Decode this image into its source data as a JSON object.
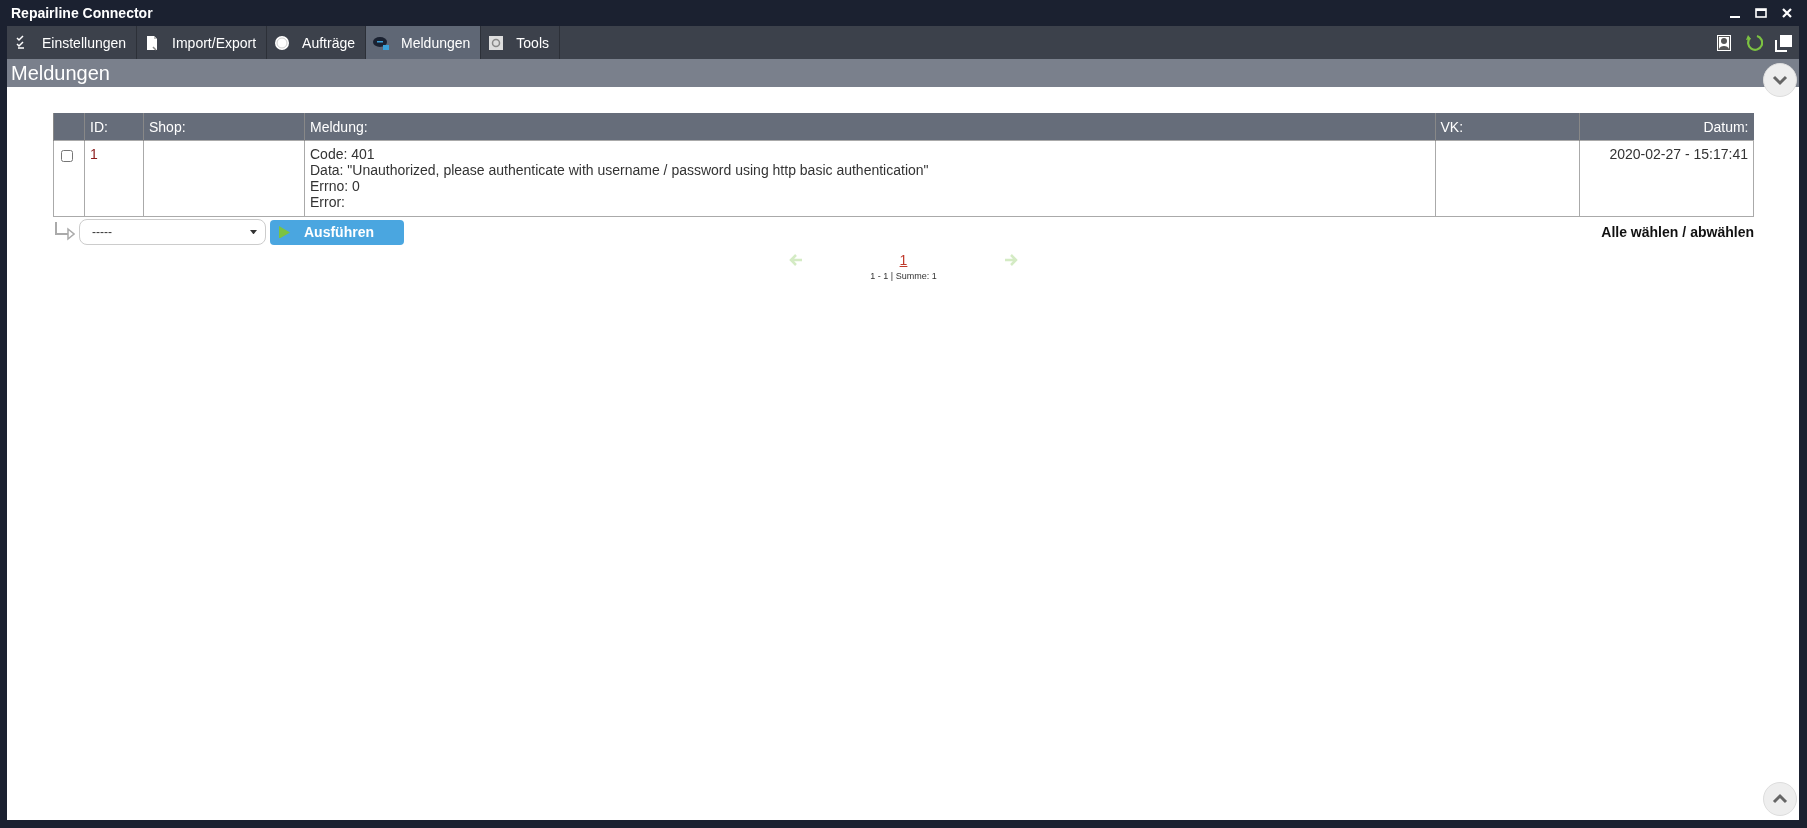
{
  "window": {
    "title": "Repairline Connector"
  },
  "tabs": [
    {
      "label": "Einstellungen",
      "kind": "checklist",
      "selected": false
    },
    {
      "label": "Import/Export",
      "kind": "document",
      "selected": false
    },
    {
      "label": "Aufträge",
      "kind": "circle",
      "selected": false
    },
    {
      "label": "Meldungen",
      "kind": "chat",
      "selected": true
    },
    {
      "label": "Tools",
      "kind": "gear",
      "selected": false
    }
  ],
  "heading": "Meldungen",
  "table": {
    "columns": [
      "ID:",
      "Shop:",
      "Meldung:",
      "VK:",
      "Datum:"
    ],
    "rows": [
      {
        "checked": false,
        "id": "1",
        "shop": "",
        "message": [
          "Code: 401",
          "Data: \"Unauthorized, please authenticate with username / password using http basic authentication\"",
          "Errno: 0",
          "Error:"
        ],
        "vk": "",
        "date": "2020-02-27 - 15:17:41"
      }
    ]
  },
  "bulk": {
    "select_value": "-----",
    "button": "Ausführen"
  },
  "select_all": [
    "Alle wählen",
    "/",
    "abwählen"
  ],
  "pagination": {
    "prev_disabled": true,
    "next_disabled": true,
    "pages": [
      {
        "label": "1",
        "selected": true
      }
    ],
    "summary": "1 - 1 | Summe: 1"
  }
}
